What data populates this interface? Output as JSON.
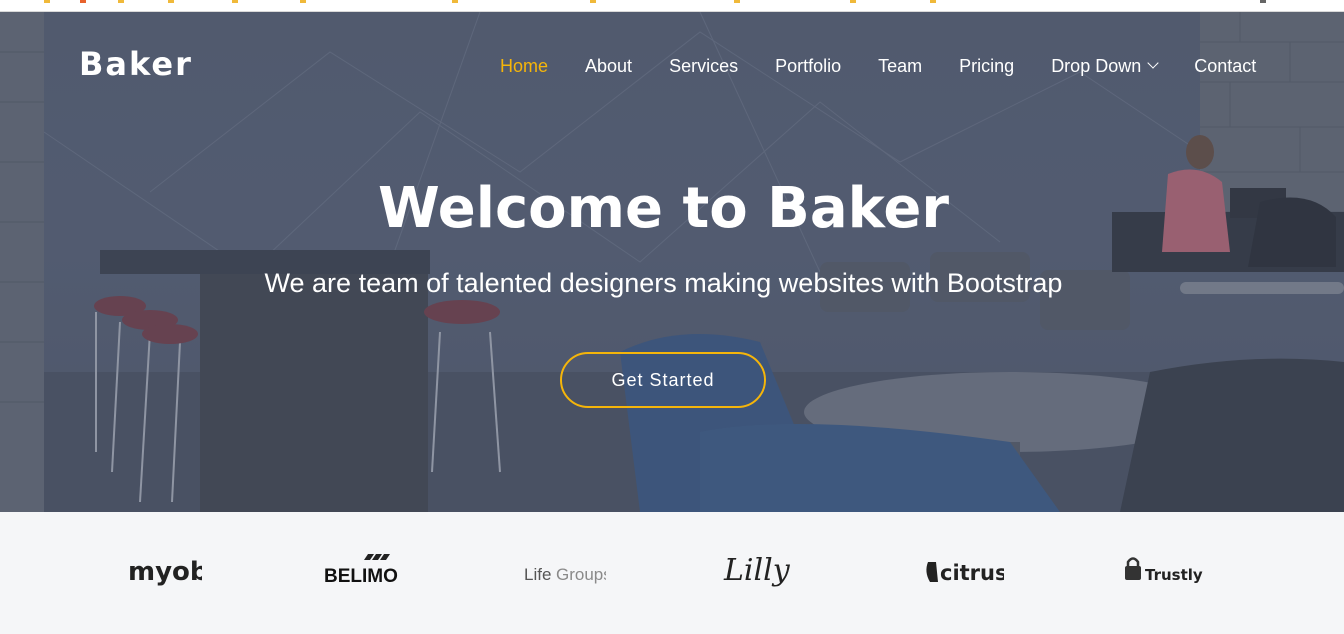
{
  "brand": {
    "name": "Baker"
  },
  "nav": {
    "items": [
      {
        "label": "Home",
        "active": true
      },
      {
        "label": "About"
      },
      {
        "label": "Services"
      },
      {
        "label": "Portfolio"
      },
      {
        "label": "Team"
      },
      {
        "label": "Pricing"
      },
      {
        "label": "Drop Down",
        "has_dropdown": true,
        "icon": "chevron-down-icon"
      },
      {
        "label": "Contact"
      }
    ]
  },
  "hero": {
    "title": "Welcome to Baker",
    "subtitle": "We are team of talented designers making websites with Bootstrap",
    "cta_label": "Get Started",
    "background": "office lounge photo with dark overlay"
  },
  "clients": {
    "logos": [
      {
        "name": "myob"
      },
      {
        "name": "BELIMO"
      },
      {
        "name_part1": "Life",
        "name_part2": "Groups"
      },
      {
        "name": "Lilly"
      },
      {
        "name": "citrus"
      },
      {
        "name": "Trustly"
      }
    ]
  },
  "colors": {
    "accent": "#f5b50a",
    "overlay": "#5a6274",
    "clients_bg": "#f5f6f8"
  }
}
